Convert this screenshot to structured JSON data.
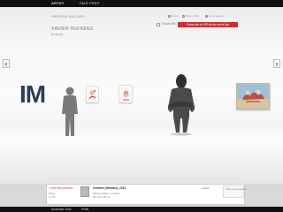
{
  "topbar": {
    "brand": "ARTSY",
    "nav_fair": "FAIR PREP"
  },
  "header": {
    "eyebrow": "PREVIEW GALLERY",
    "artist_name": "XAVIER HUFKENS",
    "sub_label": "Brussels"
  },
  "utility": {
    "share": "share",
    "cube": "View in 3D",
    "email": "email gallery"
  },
  "follow": {
    "label": "Follow IRL"
  },
  "cta": {
    "label": "Subscribe to VIP for the entire fair"
  },
  "nav": {
    "prev": "‹",
    "next": "›"
  },
  "booth": {
    "im_text": "IM"
  },
  "caption": {
    "link": "« view the previous",
    "title": "Untitled (Woman), 2012",
    "meta_line_1": "Painted plaster on wood",
    "meta_line_2": "98 x 51 x 37 cm",
    "mini_1": "Work",
    "mini_2": "1 of 6",
    "info_link": "Inquire",
    "price": "Price upon request"
  },
  "bottombar": {
    "download": "Download Tools",
    "prints": "Prints"
  },
  "colors": {
    "accent": "#d62a2a",
    "topbar": "#111111",
    "wall": "#f7f7f7"
  }
}
